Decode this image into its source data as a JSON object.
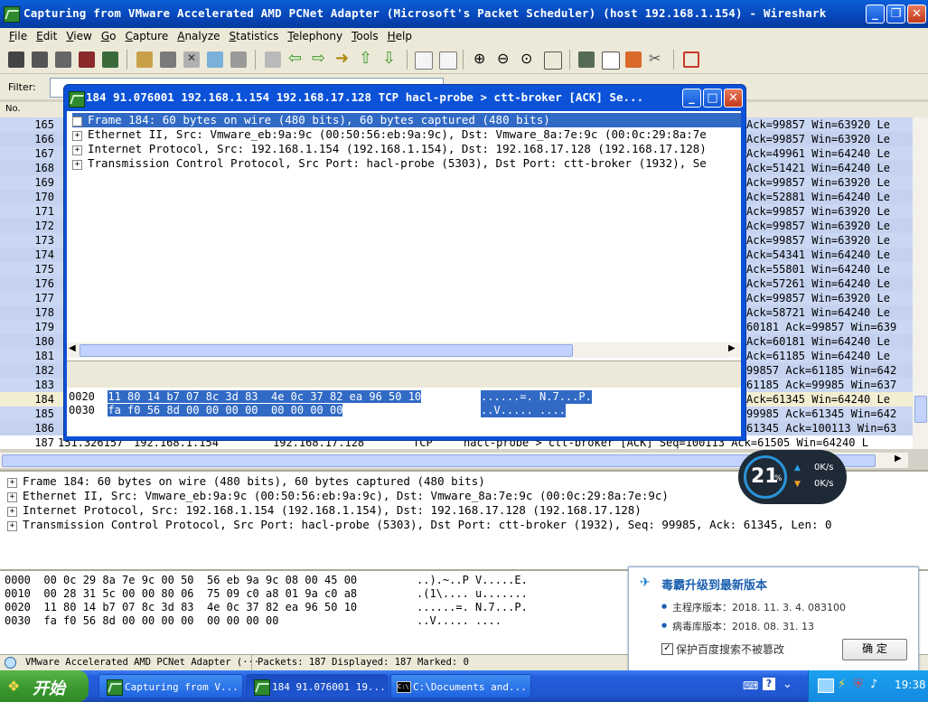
{
  "window": {
    "title": "Capturing from VMware Accelerated AMD PCNet Adapter (Microsoft's Packet Scheduler)  (host 192.168.1.154) - Wireshark"
  },
  "menu": [
    "File",
    "Edit",
    "View",
    "Go",
    "Capture",
    "Analyze",
    "Statistics",
    "Telephony",
    "Tools",
    "Help"
  ],
  "filter": {
    "label": "Filter:",
    "value": ""
  },
  "columns": {
    "no": "No."
  },
  "packets": [
    {
      "no": "165",
      "info": "Ack=99857 Win=63920 Le"
    },
    {
      "no": "166",
      "info": "Ack=99857 Win=63920 Le"
    },
    {
      "no": "167",
      "info": "Ack=49961 Win=64240 Le"
    },
    {
      "no": "168",
      "info": "Ack=51421 Win=64240 Le"
    },
    {
      "no": "169",
      "info": "Ack=99857 Win=63920 Le"
    },
    {
      "no": "170",
      "info": "Ack=52881 Win=64240 Le"
    },
    {
      "no": "171",
      "info": "Ack=99857 Win=63920 Le"
    },
    {
      "no": "172",
      "info": "Ack=99857 Win=63920 Le"
    },
    {
      "no": "173",
      "info": "Ack=99857 Win=63920 Le"
    },
    {
      "no": "174",
      "info": "Ack=54341 Win=64240 Le"
    },
    {
      "no": "175",
      "info": "Ack=55801 Win=64240 Le"
    },
    {
      "no": "176",
      "info": "Ack=57261 Win=64240 Le"
    },
    {
      "no": "177",
      "info": "Ack=99857 Win=63920 Le"
    },
    {
      "no": "178",
      "info": "Ack=58721 Win=64240 Le"
    },
    {
      "no": "179",
      "info": "60181 Ack=99857 Win=639"
    },
    {
      "no": "180",
      "info": "Ack=60181 Win=64240 Le"
    },
    {
      "no": "181",
      "info": "Ack=61185 Win=64240 Le"
    },
    {
      "no": "182",
      "info": "99857 Ack=61185 Win=642"
    },
    {
      "no": "183",
      "info": "61185 Ack=99985 Win=637"
    },
    {
      "no": "184",
      "info": "Ack=61345 Win=64240 Le"
    },
    {
      "no": "185",
      "info": "99985 Ack=61345 Win=642"
    },
    {
      "no": "186",
      "info": "61345 Ack=100113 Win=63"
    }
  ],
  "last_packet": {
    "no": "187",
    "time": "151.326157",
    "src": "192.168.1.154",
    "dst": "192.168.17.128",
    "proto": "TCP",
    "info": "hacl-probe > ctt-broker [ACK] Seq=100113 Ack=61505 Win=64240 L"
  },
  "details": [
    "Frame 184: 60 bytes on wire (480 bits), 60 bytes captured (480 bits)",
    "Ethernet II, Src: Vmware_eb:9a:9c (00:50:56:eb:9a:9c), Dst: Vmware_8a:7e:9c (00:0c:29:8a:7e:9c)",
    "Internet Protocol, Src: 192.168.1.154 (192.168.1.154), Dst: 192.168.17.128 (192.168.17.128)",
    "Transmission Control Protocol, Src Port: hacl-probe (5303), Dst Port: ctt-broker (1932), Seq: 99985, Ack: 61345, Len: 0"
  ],
  "bytes": [
    {
      "off": "0000",
      "hex": "00 0c 29 8a 7e 9c 00 50  56 eb 9a 9c 08 00 45 00",
      "asc": "..).~..P V.....E."
    },
    {
      "off": "0010",
      "hex": "00 28 31 5c 00 00 80 06  75 09 c0 a8 01 9a c0 a8",
      "asc": ".(1\\.... u......."
    },
    {
      "off": "0020",
      "hex": "11 80 14 b7 07 8c 3d 83  4e 0c 37 82 ea 96 50 10",
      "asc": "......=. N.7...P."
    },
    {
      "off": "0030",
      "hex": "fa f0 56 8d 00 00 00 00  00 00 00 00",
      "asc": "..V..... ...."
    }
  ],
  "status": {
    "adapter": "VMware Accelerated AMD PCNet Adapter (···",
    "packets": "Packets: 187 Displayed: 187 Marked: 0"
  },
  "popup": {
    "title": "184 91.076001 192.168.1.154 192.168.17.128 TCP hacl-probe > ctt-broker [ACK] Se...",
    "details": [
      "Frame 184: 60 bytes on wire (480 bits), 60 bytes captured (480 bits)",
      "Ethernet II, Src: Vmware_eb:9a:9c (00:50:56:eb:9a:9c), Dst: Vmware_8a:7e:9c (00:0c:29:8a:7e",
      "Internet Protocol, Src: 192.168.1.154 (192.168.1.154), Dst: 192.168.17.128 (192.168.17.128)",
      "Transmission Control Protocol, Src Port: hacl-probe (5303), Dst Port: ctt-broker (1932), Se"
    ],
    "bytes": [
      {
        "off": "0020",
        "hex": "11 80 14 b7 07 8c 3d 83  4e 0c 37 82 ea 96 50 10",
        "asc": "......=. N.7...P."
      },
      {
        "off": "0030",
        "hex": "fa f0 56 8d 00 00 00 00  00 00 00 00",
        "asc": "..V..... ...."
      }
    ]
  },
  "speed": {
    "percent": "21",
    "unit": "%",
    "up": "0K/s",
    "down": "0K/s"
  },
  "antivirus": {
    "title": "毒霸升级到最新版本",
    "line1": "主程序版本：2018. 11. 3. 4. 083100",
    "line2": "病毒库版本：2018. 08. 31. 13",
    "checkbox": "保护百度搜索不被篡改",
    "ok": "确 定"
  },
  "taskbar": {
    "start": "开始",
    "tasks": [
      "Capturing from V...",
      "184 91.076001 19...",
      "C:\\Documents and..."
    ],
    "clock": "19:38"
  },
  "colors": {
    "selection": "#316ac5",
    "titlebar": "#0a5fd8",
    "row_bg": "#c9d7f3"
  }
}
